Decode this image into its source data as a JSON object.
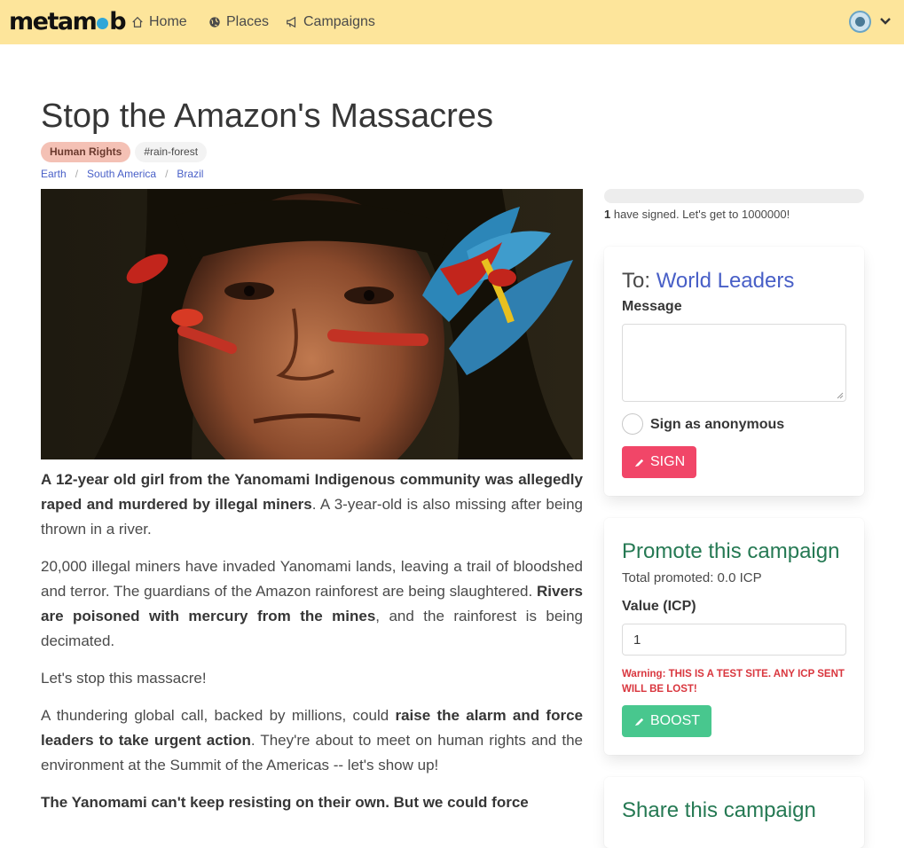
{
  "nav": {
    "logo_left": "metam",
    "logo_right": "b",
    "home": "Home",
    "places": "Places",
    "campaigns": "Campaigns"
  },
  "campaign": {
    "title": "Stop the Amazon's Massacres",
    "category": "Human Rights",
    "hashtag": "#rain-forest",
    "breadcrumb": [
      "Earth",
      "South America",
      "Brazil"
    ],
    "hero_icon": "portrait-photo"
  },
  "article": {
    "p1_bold": "A 12-year old girl from the Yanomami Indigenous community was allegedly raped and murdered by illegal miners",
    "p1_rest": ". A 3-year-old is also missing after being thrown in a river.",
    "p2_start": "20,000 illegal miners have invaded Yanomami lands, leaving a trail of bloodshed and terror. The guardians of the Amazon rainforest are being slaughtered. ",
    "p2_bold": "Rivers are poisoned with mercury from the mines",
    "p2_end": ", and the rainforest is being decimated.",
    "p3": "Let's stop this massacre!",
    "p4_start": "A thundering global call, backed by millions, could ",
    "p4_bold": "raise the alarm and force leaders to take urgent action",
    "p4_end": ". They're about to meet on human rights and the environment at the Summit of the Americas -- let's show up!",
    "p5_bold": "The Yanomami can't keep resisting on their own. But we could force"
  },
  "signatures": {
    "count": "1",
    "text": " have signed. Let's get to 1000000!",
    "progress": 1e-06
  },
  "sign_card": {
    "to_label": "To: ",
    "to_target": "World Leaders",
    "message_label": "Message",
    "anonymous_label": "Sign as anonymous",
    "sign_button": "SIGN"
  },
  "promote_card": {
    "title": "Promote this campaign",
    "total": "Total promoted: 0.0 ICP",
    "value_label": "Value (ICP)",
    "value": "1",
    "warning": "Warning: THIS IS A TEST SITE. ANY ICP SENT WILL BE LOST!",
    "boost_button": "BOOST"
  },
  "share_card": {
    "title": "Share this campaign"
  },
  "colors": {
    "navbar": "#fde59b",
    "link": "#485fc7",
    "sign": "#f14668",
    "boost": "#48c78e",
    "promote_title": "#257953",
    "warning": "#d9363e"
  }
}
